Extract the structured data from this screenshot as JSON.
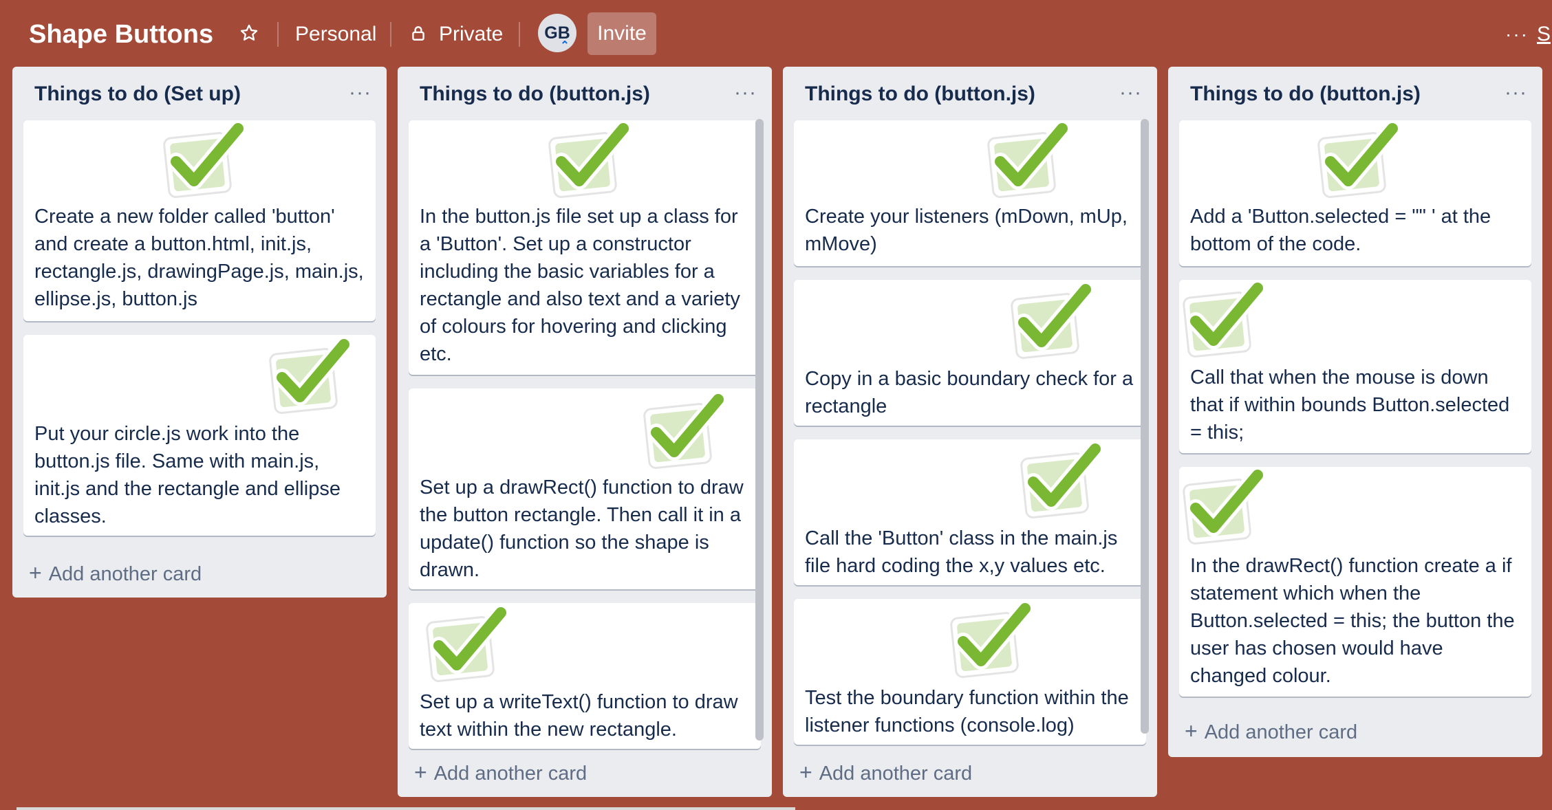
{
  "header": {
    "board_title": "Shape Buttons",
    "workspace_label": "Personal",
    "visibility_label": "Private",
    "avatar_initials": "GB",
    "invite_label": "Invite",
    "more_label": "···",
    "cut_label": "S"
  },
  "icons": {
    "star": "star-icon",
    "lock": "lock-icon",
    "check": "checkmark-image",
    "more": "ellipsis-icon",
    "plus": "plus-icon"
  },
  "colors": {
    "board_background": "#a34a38",
    "list_background": "#ebecf0",
    "card_background": "#ffffff",
    "check_green": "#7ab834"
  },
  "lists": [
    {
      "title": "Things to do (Set up)",
      "menu_label": "···",
      "add_label": "Add another card",
      "cards": [
        {
          "text": "Create a new folder called 'button' and create a button.html, init.js, rectangle.js, drawingPage.js, main.js, ellipse.js, button.js"
        },
        {
          "text": "Put your circle.js work into the button.js file. Same with main.js, init.js and the rectangle and ellipse classes."
        }
      ]
    },
    {
      "title": "Things to do (button.js)",
      "menu_label": "···",
      "add_label": "Add another card",
      "cards": [
        {
          "text": "In the button.js file set up a class for a 'Button'. Set up a constructor including the basic variables for a rectangle and also text and a variety of colours for hovering and clicking etc."
        },
        {
          "text": "Set up a drawRect() function to draw the button rectangle. Then call it in a update() function so the shape is drawn."
        },
        {
          "text": "Set up a writeText() function to draw text within the new rectangle."
        }
      ]
    },
    {
      "title": "Things to do (button.js)",
      "menu_label": "···",
      "add_label": "Add another card",
      "cards": [
        {
          "text": "Create your listeners (mDown, mUp, mMove)"
        },
        {
          "text": "Copy in a basic boundary check for a rectangle"
        },
        {
          "text": "Call the 'Button' class in the main.js file hard coding the x,y values etc."
        },
        {
          "text": "Test the boundary function within the listener functions (console.log)"
        }
      ]
    },
    {
      "title": "Things to do (button.js)",
      "menu_label": "···",
      "add_label": "Add another card",
      "cards": [
        {
          "text": "Add a 'Button.selected = \"\" ' at the bottom of the code."
        },
        {
          "text": "Call that when the mouse is down that if within bounds Button.selected = this;"
        },
        {
          "text": "In the drawRect() function create a if statement which when the Button.selected = this; the button the user has chosen would have changed colour."
        }
      ]
    }
  ]
}
